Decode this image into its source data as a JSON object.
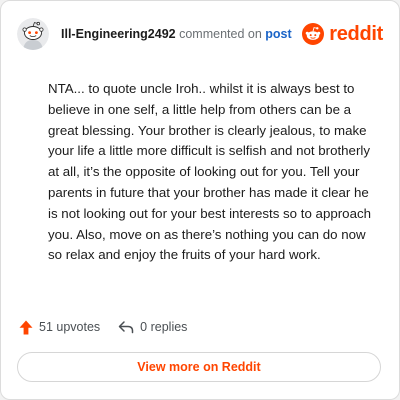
{
  "comment": {
    "username": "Ill-Engineering2492",
    "action_text": "commented on",
    "post_link_label": "post",
    "body": "NTA... to quote uncle Iroh.. whilst it is always best to believe in one self, a little help from others can be a great blessing. Your brother is clearly jealous, to make your life a little more difficult is selfish and not brotherly at all, it’s the opposite of looking out for you. Tell your parents in future that your brother has made it clear he is not looking out for your best interests so to approach you. Also, move on as there’s nothing you can do now so relax and enjoy the fruits of your hard work."
  },
  "brand": {
    "name": "reddit",
    "icon": "reddit-snoo-logo",
    "color": "#ff4500"
  },
  "stats": {
    "upvotes_label": "51 upvotes",
    "upvote_icon": "upvote-arrow-icon",
    "replies_label": "0 replies",
    "reply_icon": "reply-arrow-icon"
  },
  "footer": {
    "view_more_label": "View more on Reddit"
  }
}
